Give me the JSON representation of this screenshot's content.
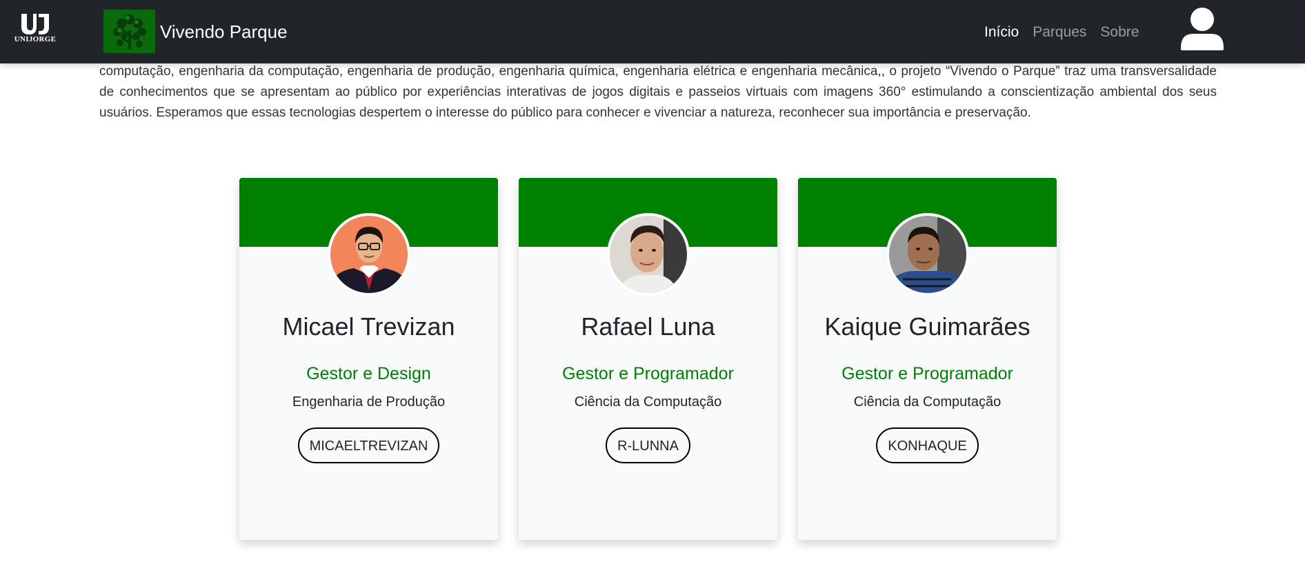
{
  "navbar": {
    "institution_logo_text": "UNIJORGE",
    "brand_title": "Vivendo Parque",
    "links": [
      {
        "label": "Início",
        "active": true
      },
      {
        "label": "Parques",
        "active": false
      },
      {
        "label": "Sobre",
        "active": false
      }
    ],
    "user_icon": "user-icon"
  },
  "intro_text": "computação, engenharia da computação, engenharia de produção, engenharia química, engenharia elétrica e engenharia mecânica,, o projeto “Vivendo o Parque” traz uma transversalidade de conhecimentos que se apresentam ao público por experiências interativas de jogos digitais e passeios virtuais com imagens 360° estimulando a conscientização ambiental dos seus usuários. Esperamos que essas tecnologias despertem o interesse do público para conhecer e vivenciar a natureza, reconhecer sua importância e preservação.",
  "team": [
    {
      "name": "Micael Trevizan",
      "role": "Gestor e Design",
      "course": "Engenharia de Produção",
      "button": "MICAELTREVIZAN"
    },
    {
      "name": "Rafael Luna",
      "role": "Gestor e Programador",
      "course": "Ciência da Computação",
      "button": "R-LUNNA"
    },
    {
      "name": "Kaique Guimarães",
      "role": "Gestor e Programador",
      "course": "Ciência da Computação",
      "button": "KONHAQUE"
    }
  ],
  "colors": {
    "navbar_bg": "#212529",
    "accent_green": "#008000",
    "card_bg": "#f8f9fa"
  }
}
